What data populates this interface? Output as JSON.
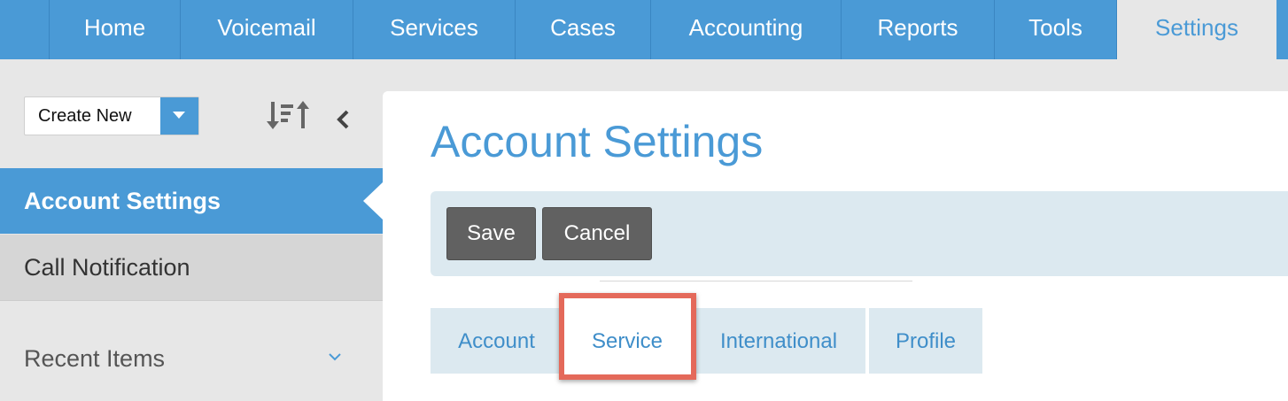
{
  "nav": {
    "tabs": [
      {
        "label": "Home"
      },
      {
        "label": "Voicemail"
      },
      {
        "label": "Services"
      },
      {
        "label": "Cases"
      },
      {
        "label": "Accounting"
      },
      {
        "label": "Reports"
      },
      {
        "label": "Tools"
      },
      {
        "label": "Settings",
        "active": true
      }
    ]
  },
  "sidebar": {
    "create_new_label": "Create New",
    "items": [
      {
        "label": "Account Settings",
        "active": true
      },
      {
        "label": "Call Notification"
      }
    ],
    "recent_items_label": "Recent Items"
  },
  "main": {
    "title": "Account Settings",
    "save_label": "Save",
    "cancel_label": "Cancel",
    "tabs": [
      {
        "label": "Account"
      },
      {
        "label": "Service",
        "active": true
      },
      {
        "label": "International"
      },
      {
        "label": "Profile"
      }
    ]
  },
  "colors": {
    "accent": "#4a9ad6",
    "highlight": "#e4695a",
    "button": "#616161"
  },
  "icons": [
    "caret-down-icon",
    "sort-icon",
    "collapse-left-icon",
    "chevron-down-icon"
  ]
}
